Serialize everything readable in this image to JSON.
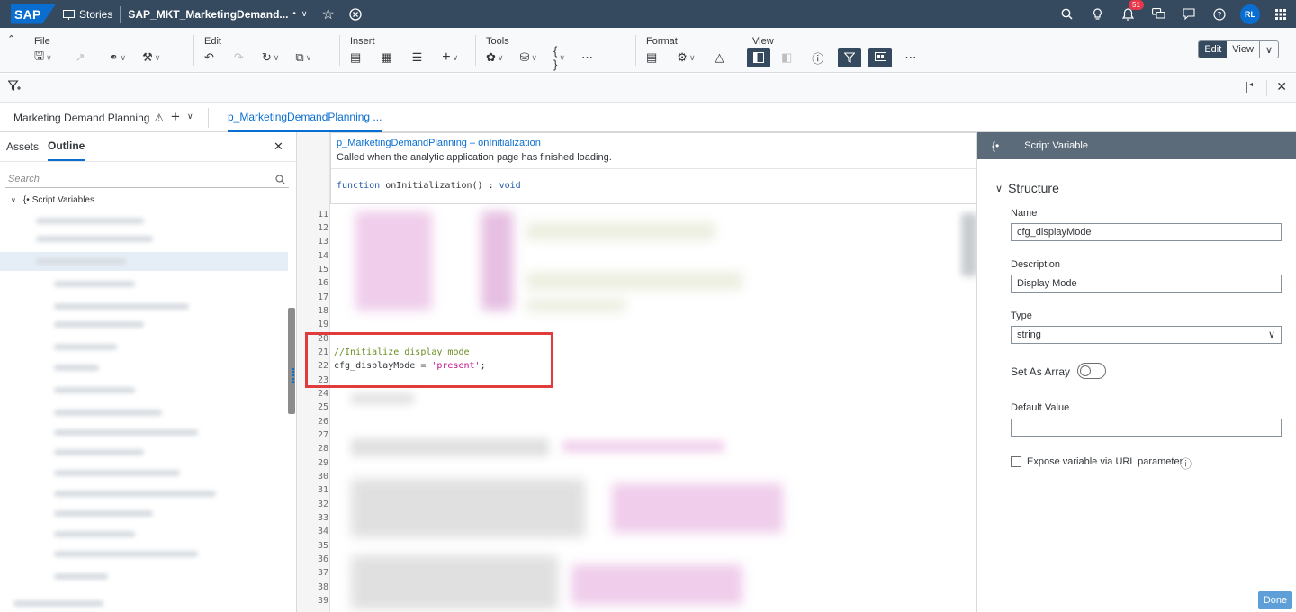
{
  "shell": {
    "logo": "SAP",
    "stories_label": "Stories",
    "story_title": "SAP_MKT_MarketingDemand...",
    "modified_dot": "•",
    "notification_count": "51",
    "avatar_initials": "RL"
  },
  "toolbar": {
    "file_label": "File",
    "edit_label": "Edit",
    "insert_label": "Insert",
    "tools_label": "Tools",
    "format_label": "Format",
    "view_label": "View",
    "mode_edit": "Edit",
    "mode_view": "View"
  },
  "tabs": {
    "page_tab": "Marketing Demand Planning",
    "script_tab": "p_MarketingDemandPlanning ..."
  },
  "left_panel": {
    "tab_assets": "Assets",
    "tab_outline": "Outline",
    "search_placeholder": "Search",
    "tree_node": "Script Variables"
  },
  "editor": {
    "info_title": "p_MarketingDemandPlanning – onInitialization",
    "info_desc": "Called when the analytic application page has finished loading.",
    "signature_keyword": "function",
    "signature_name": " onInitialization() : ",
    "signature_return": "void",
    "line_numbers": [
      "11",
      "12",
      "13",
      "14",
      "15",
      "16",
      "17",
      "18",
      "19",
      "20",
      "21",
      "22",
      "23",
      "24",
      "25",
      "26",
      "27",
      "28",
      "29",
      "30",
      "31",
      "32",
      "33",
      "34",
      "35",
      "36",
      "37",
      "38",
      "39"
    ],
    "comment_line": "//Initialize display mode",
    "code_var": "cfg_displayMode = ",
    "code_string": "'present'",
    "code_end": ";"
  },
  "right_panel": {
    "header": "Script Variable",
    "section_title": "Structure",
    "name_label": "Name",
    "name_value": "cfg_displayMode",
    "description_label": "Description",
    "description_value": "Display Mode",
    "type_label": "Type",
    "type_value": "string",
    "array_label": "Set As Array",
    "default_label": "Default Value",
    "default_value": "",
    "expose_label": "Expose variable via URL parameter",
    "done_label": "Done"
  },
  "colors": {
    "shell_bg": "#354a5f",
    "accent": "#0a6ed1",
    "comment": "#6b8e23",
    "string": "#c0138c",
    "keyword": "#1f5ba8",
    "highlight_border": "#e03c3c"
  }
}
